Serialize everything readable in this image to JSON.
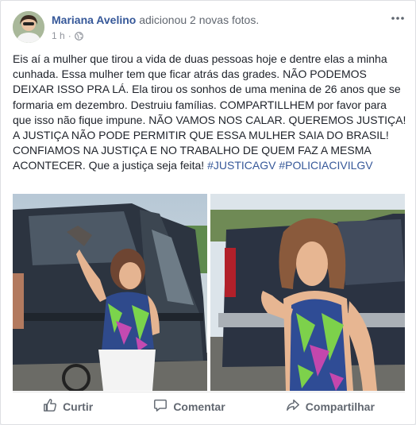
{
  "post": {
    "author": "Mariana Avelino",
    "action": "adicionou 2 novas fotos.",
    "time": "1 h",
    "separator": "·",
    "text_main": "Eis aí a mulher que tirou a vida de duas pessoas hoje e dentre elas a minha cunhada. Essa mulher tem que ficar atrás das grades. NÃO PODEMOS DEIXAR ISSO PRA LÁ. Ela tirou os sonhos de uma menina de 26 anos que se formaria em dezembro. Destruiu famílias. COMPARTILLHEM por favor para que isso não fique impune. NÃO VAMOS NOS CALAR. QUEREMOS JUSTIÇA! A JUSTIÇA NÃO PODE PERMITIR QUE ESSA MULHER SAIA DO BRASIL! CONFIAMOS NA JUSTIÇA E NO TRABALHO DE QUEM FAZ A MESMA ACONTECER. Que a justiça seja feita!",
    "hashtag_1": "#JUSTICAGV",
    "hashtag_2": "#POLICIACIVILGV"
  },
  "actions": {
    "like": "Curtir",
    "comment": "Comentar",
    "share": "Compartilhar"
  },
  "icons": {
    "privacy": "globe-icon",
    "menu": "more-options-icon",
    "like": "thumbs-up-icon",
    "comment": "comment-bubble-icon",
    "share": "share-arrow-icon"
  },
  "colors": {
    "link": "#365899",
    "text": "#1d2129",
    "muted": "#90949c",
    "action": "#616770"
  }
}
